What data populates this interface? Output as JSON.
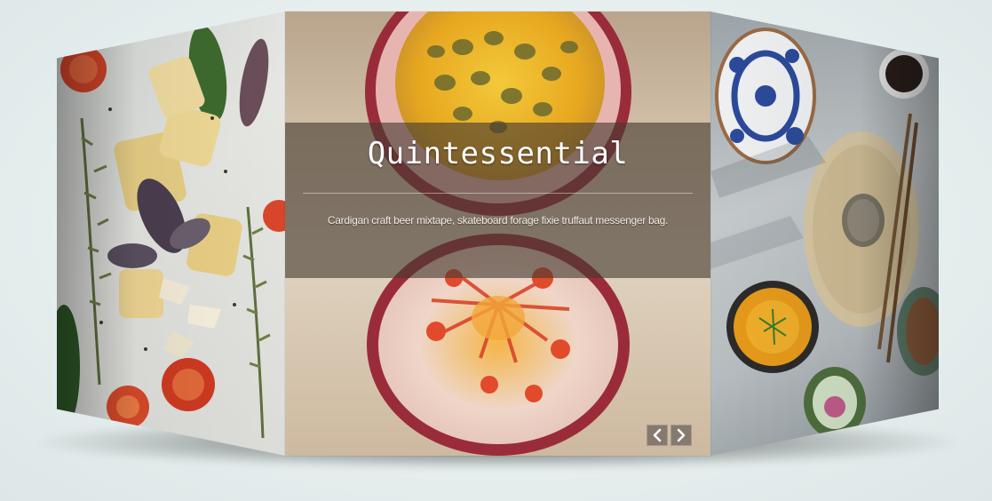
{
  "slider": {
    "caption_title": "Quintessential",
    "caption_text": "Cardigan craft beer mixtape, skateboard forage fixie truffaut messenger bag.",
    "controls": {
      "prev_icon": "chevron-left-icon",
      "next_icon": "chevron-right-icon"
    }
  },
  "colors": {
    "background": "#e6eeee",
    "caption_band": "#463a30",
    "nav_button": "#786e64"
  }
}
